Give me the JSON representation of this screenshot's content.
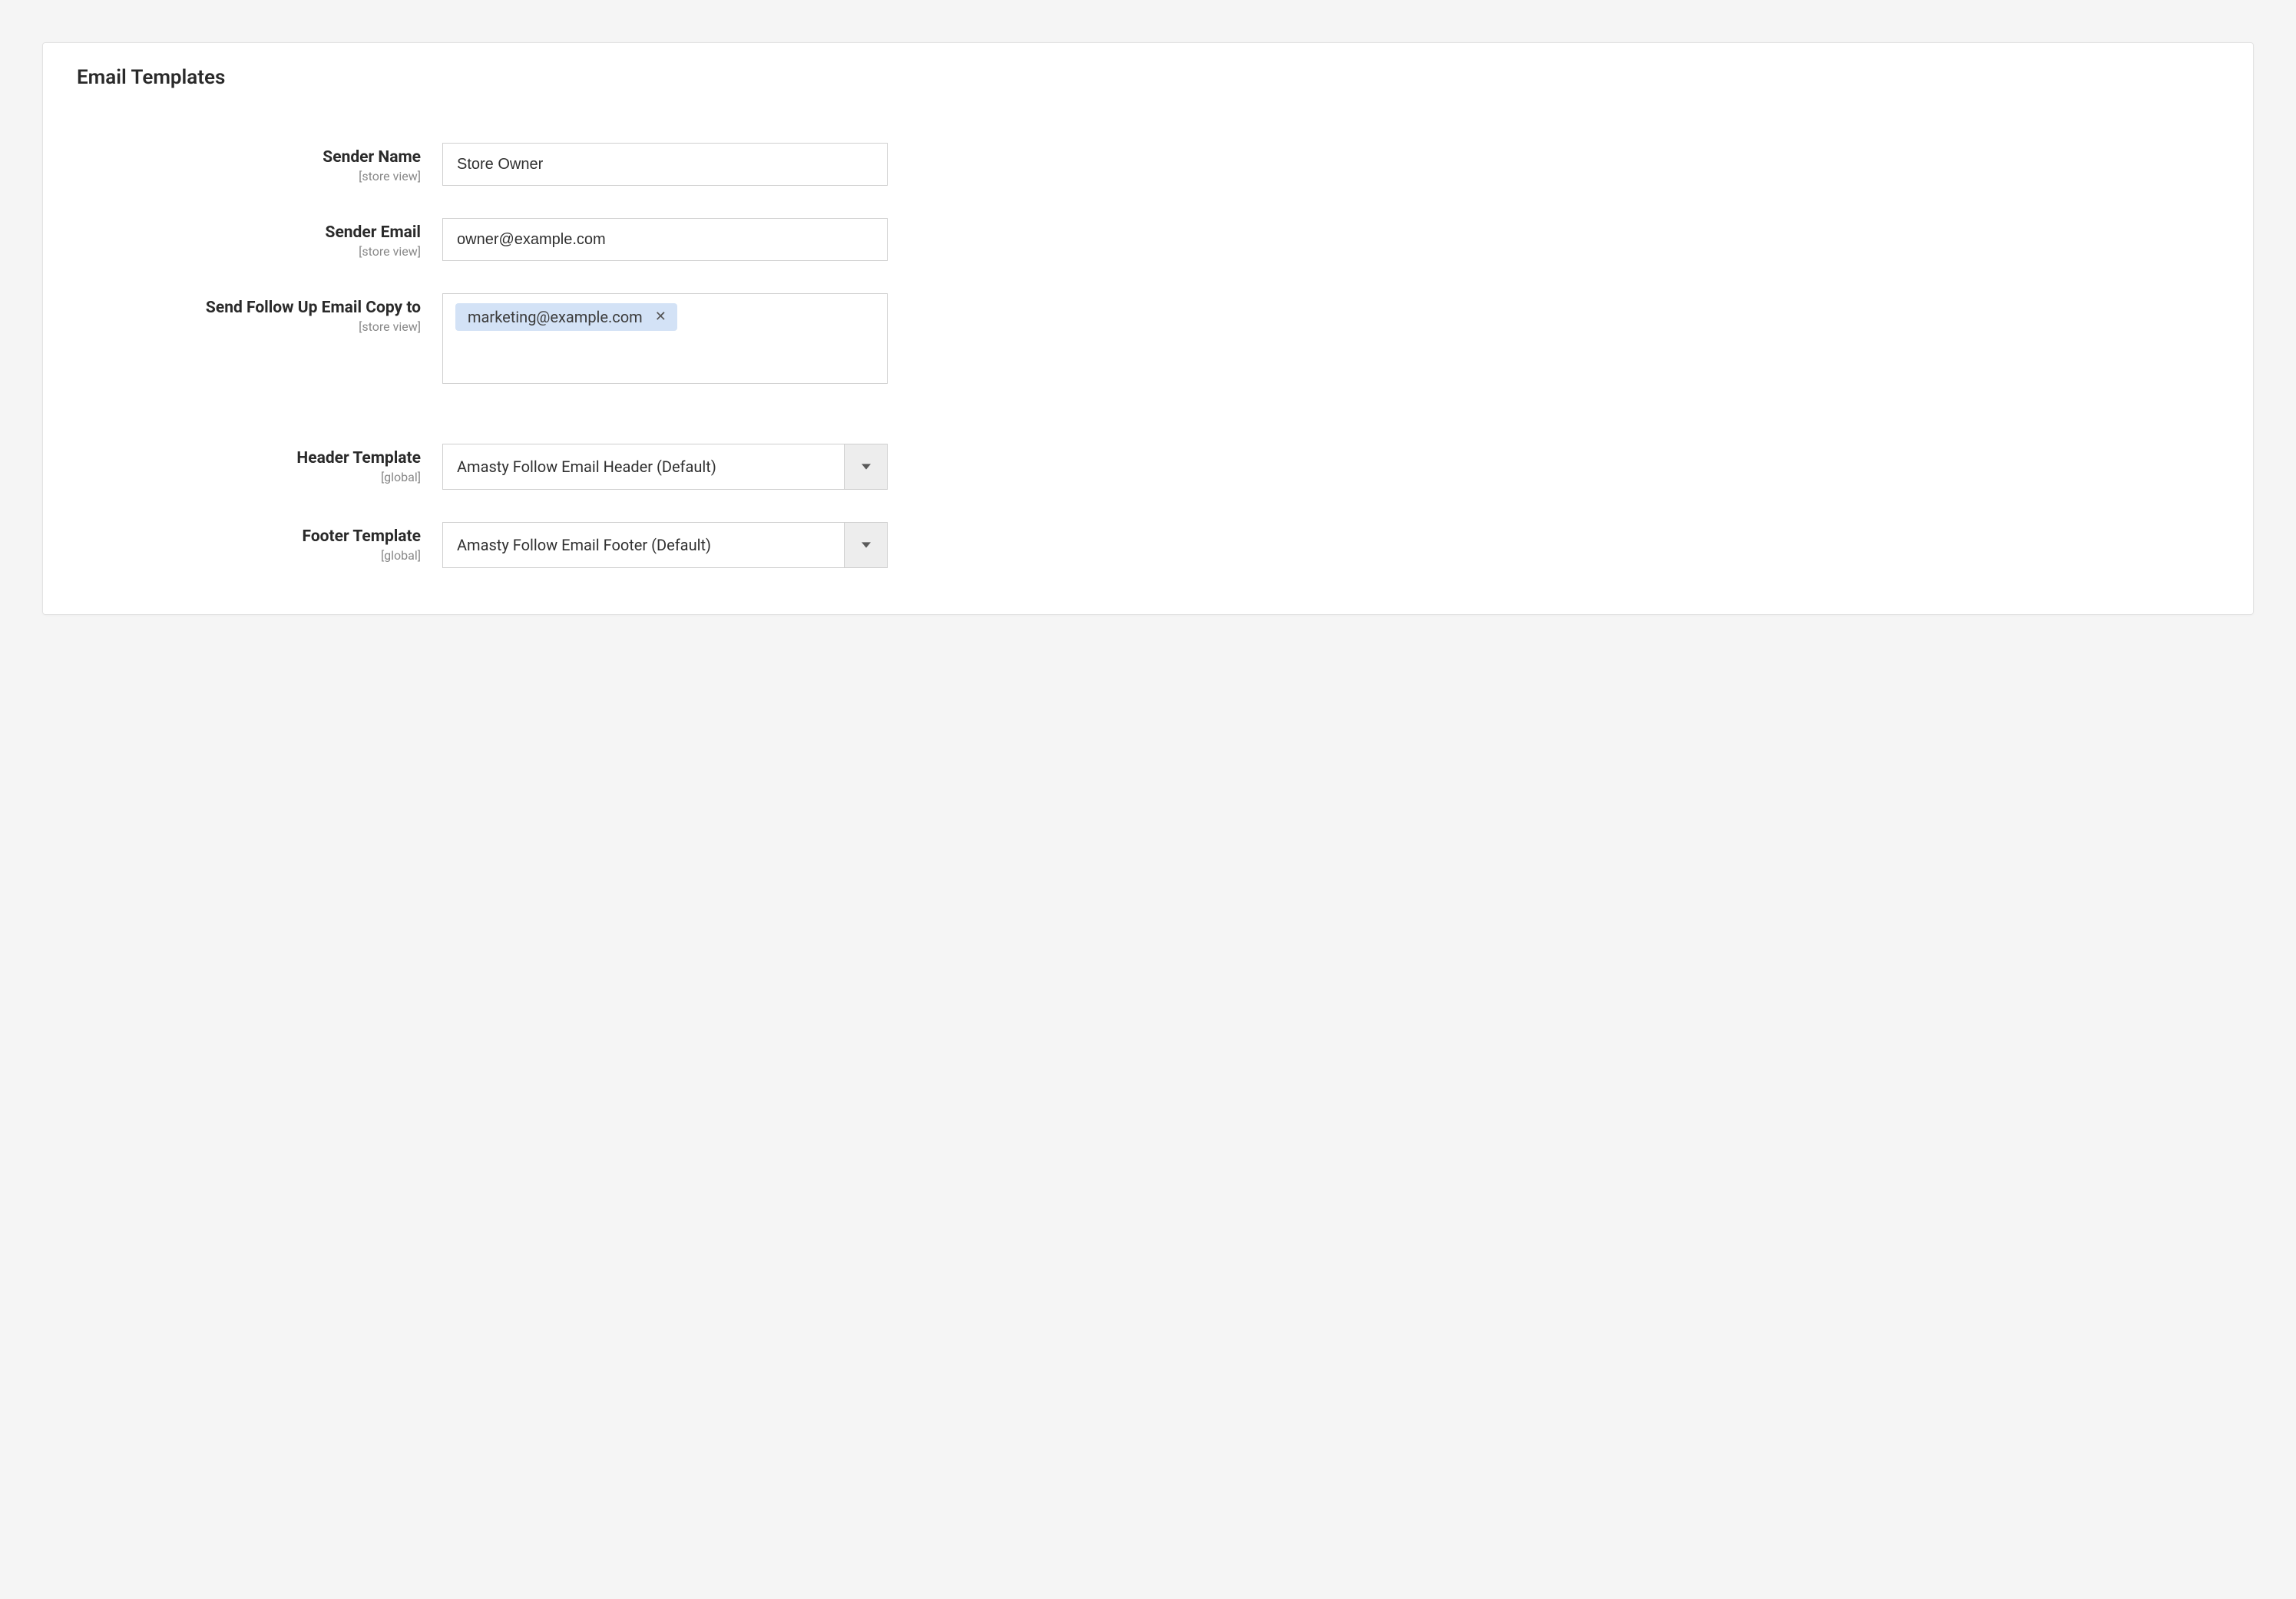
{
  "section": {
    "title": "Email Templates"
  },
  "scopes": {
    "store_view": "[store view]",
    "global": "[global]"
  },
  "fields": {
    "sender_name": {
      "label": "Sender Name",
      "value": "Store Owner"
    },
    "sender_email": {
      "label": "Sender Email",
      "value": "owner@example.com"
    },
    "copy_to": {
      "label": "Send Follow Up Email Copy to",
      "tags": [
        "marketing@example.com"
      ]
    },
    "header_template": {
      "label": "Header Template",
      "selected": "Amasty Follow Email Header (Default)"
    },
    "footer_template": {
      "label": "Footer Template",
      "selected": "Amasty Follow Email Footer (Default)"
    }
  }
}
